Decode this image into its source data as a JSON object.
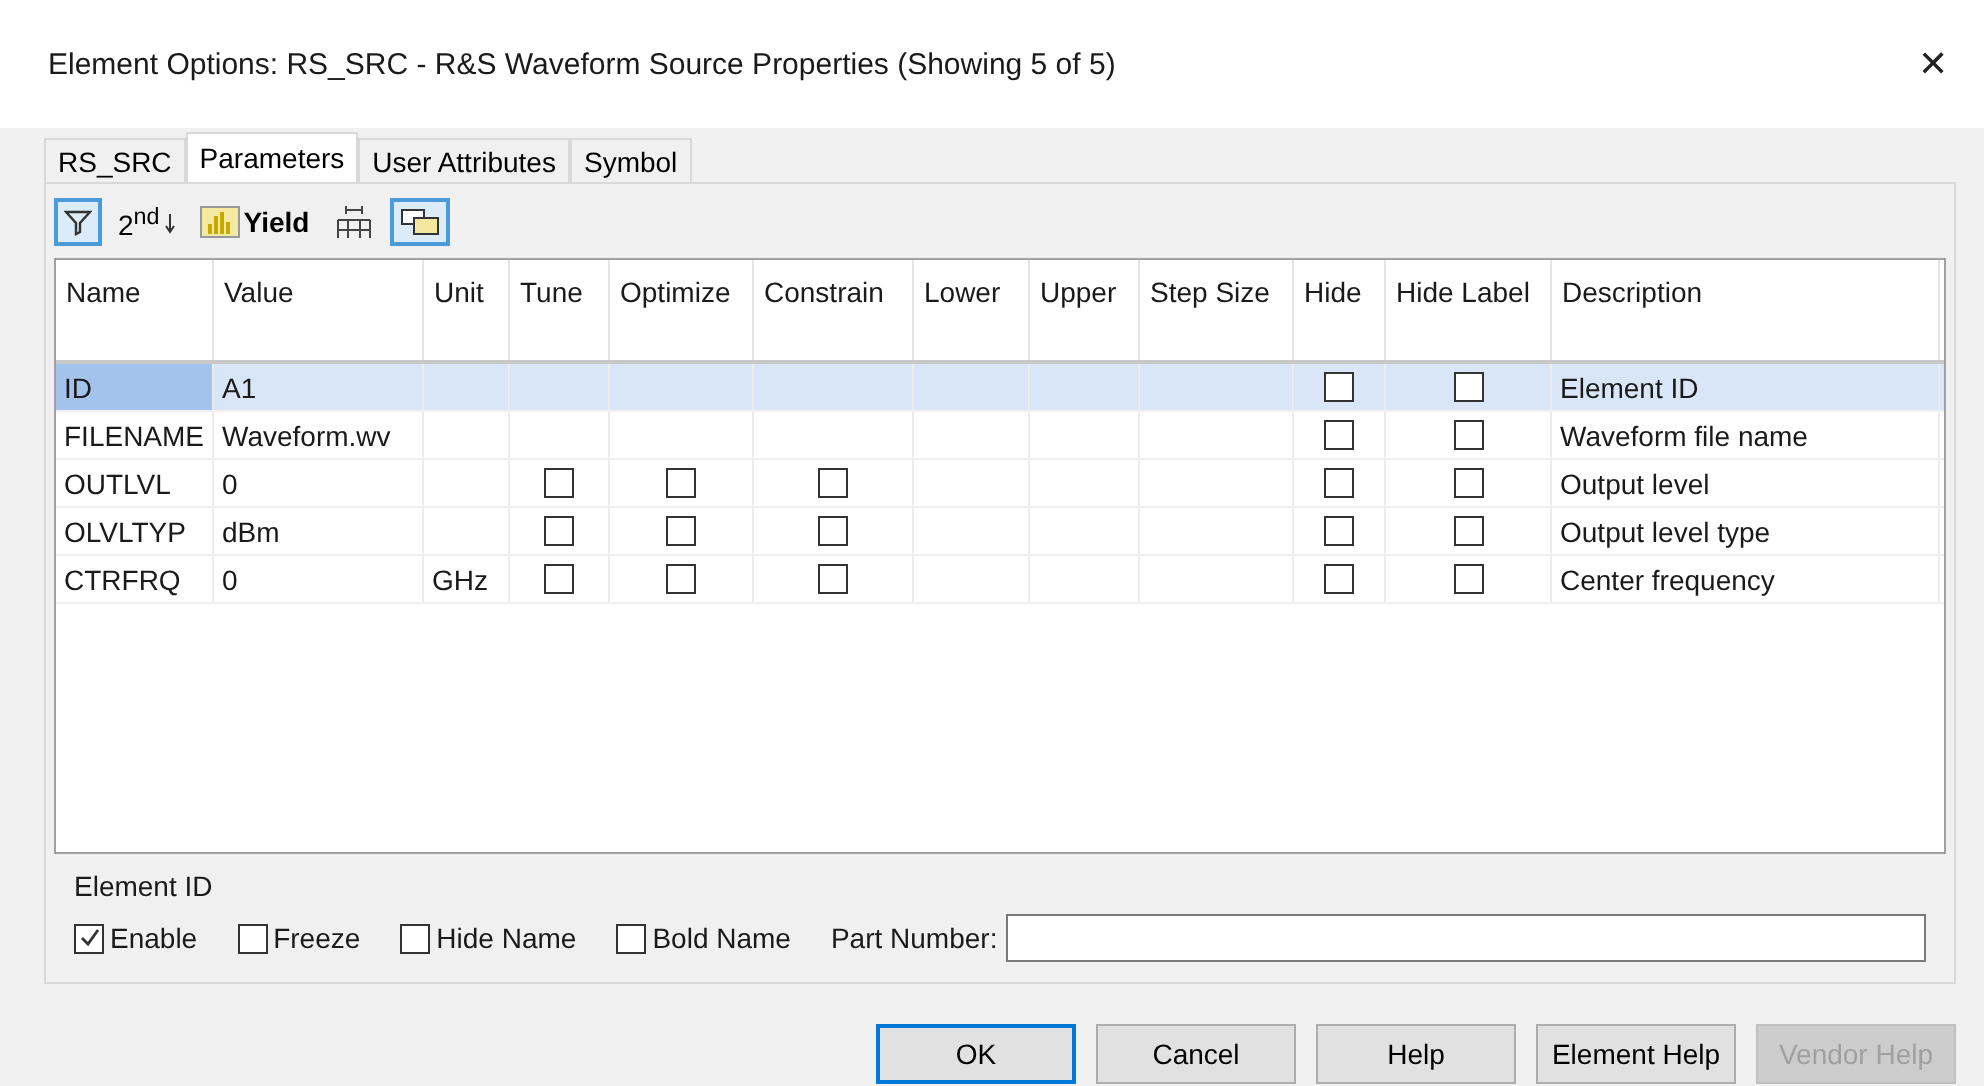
{
  "window": {
    "title": "Element Options: RS_SRC - R&S Waveform Source Properties (Showing 5 of 5)",
    "close": "✕"
  },
  "tabs": [
    {
      "label": "RS_SRC",
      "selected": false
    },
    {
      "label": "Parameters",
      "selected": true
    },
    {
      "label": "User Attributes",
      "selected": false
    },
    {
      "label": "Symbol",
      "selected": false
    }
  ],
  "toolbar": [
    {
      "kind": "filter",
      "pressed": true
    },
    {
      "kind": "text",
      "label": "2$^{nd}$",
      "pressed": false
    },
    {
      "kind": "yield",
      "label": "Yield",
      "pressed": false
    },
    {
      "kind": "columns",
      "pressed": false
    },
    {
      "kind": "windows",
      "pressed": true
    }
  ],
  "table": {
    "columns": [
      "Name",
      "Value",
      "Unit",
      "Tune",
      "Optimize",
      "Constrain",
      "Lower",
      "Upper",
      "Step Size",
      "Hide",
      "Hide Label",
      "Description"
    ],
    "rows": [
      {
        "name": "ID",
        "value": "A1",
        "selected": true,
        "hide": false,
        "hide_label": false,
        "description": "Element ID"
      },
      {
        "name": "FILENAME",
        "value": "Waveform.wv",
        "selected": false,
        "hide": false,
        "hide_label": false,
        "description": "Waveform file name"
      },
      {
        "name": "OUTLVL",
        "value": "0",
        "selected": false,
        "tune": false,
        "optimize": false,
        "constrain": false,
        "hide": false,
        "hide_label": false,
        "description": "Output level"
      },
      {
        "name": "OLVLTYP",
        "value": "dBm",
        "selected": false,
        "tune": false,
        "optimize": false,
        "constrain": false,
        "hide": false,
        "hide_label": false,
        "description": "Output level type"
      },
      {
        "name": "CTRFRQ",
        "value": "0",
        "unit": "GHz",
        "selected": false,
        "tune": false,
        "optimize": false,
        "constrain": false,
        "hide": false,
        "hide_label": false,
        "description": "Center frequency"
      }
    ]
  },
  "element_id": {
    "title": "Element ID",
    "options": [
      {
        "label": "Enable",
        "checked": true
      },
      {
        "label": "Freeze",
        "checked": false
      },
      {
        "label": "Hide Name",
        "checked": false
      },
      {
        "label": "Bold Name",
        "checked": false
      }
    ],
    "part_number": {
      "label": "Part Number:"
    }
  },
  "buttons": [
    {
      "label": "OK",
      "default": true,
      "disabled": false
    },
    {
      "label": "Cancel",
      "default": false,
      "disabled": false
    },
    {
      "label": "Help",
      "default": false,
      "disabled": false
    },
    {
      "label": "Element Help",
      "default": false,
      "disabled": false
    },
    {
      "label": "Vendor Help",
      "default": false,
      "disabled": true
    }
  ]
}
